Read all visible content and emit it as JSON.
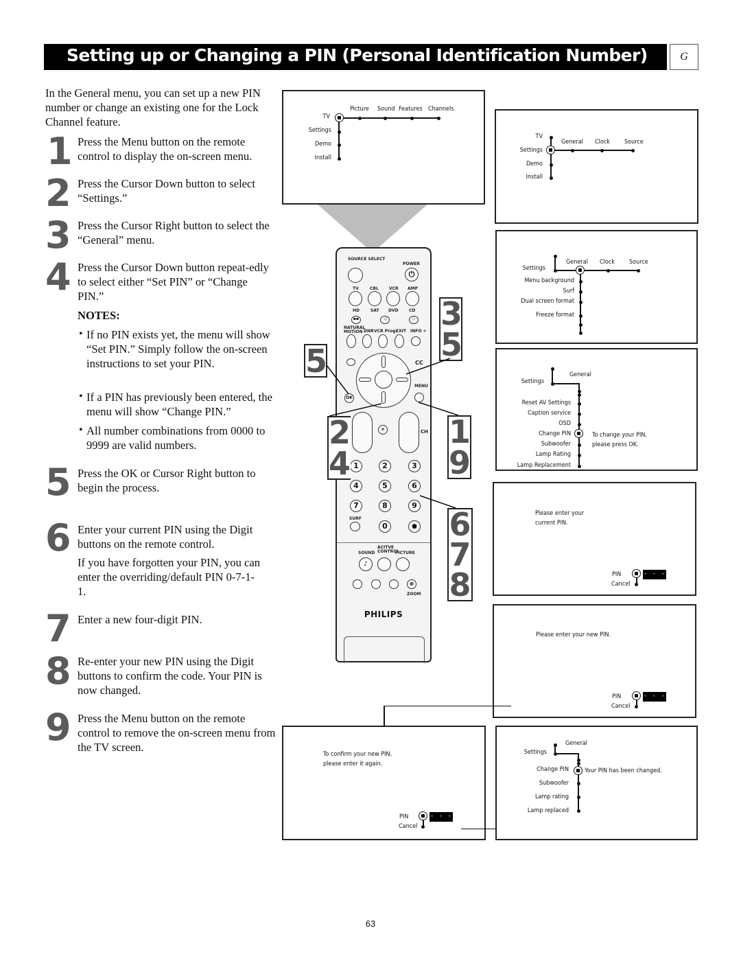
{
  "header": {
    "title": "Setting up or Changing a PIN (Personal Identification Number)",
    "section_letter": "G"
  },
  "intro": "In the General menu, you can set up a new PIN number or change an existing one for the Lock Channel feature.",
  "steps": [
    {
      "number": "1",
      "text": "Press the Menu button on the remote control to display the on-screen menu."
    },
    {
      "number": "2",
      "text": "Press the Cursor Down button to select “Settings.”"
    },
    {
      "number": "3",
      "text": "Press the Cursor Right button to select the “General” menu."
    },
    {
      "number": "4",
      "text": "Press the Cursor Down button repeat-edly to select either “Set PIN” or “Change PIN.”"
    },
    {
      "number": "5",
      "text": "Press the OK or Cursor Right button to begin the process."
    },
    {
      "number": "6",
      "text": "Enter your current PIN using the Digit buttons on the remote control.",
      "extra": "If you have forgotten your PIN, you can enter the overriding/default PIN 0-7-1-1."
    },
    {
      "number": "7",
      "text": "Enter a new four-digit PIN."
    },
    {
      "number": "8",
      "text": "Re-enter your new PIN using the Digit buttons to confirm the code. Your PIN is now changed."
    },
    {
      "number": "9",
      "text": "Press the Menu button on the remote control to remove the on-screen menu from the TV screen."
    }
  ],
  "notes": {
    "heading": "NOTES:",
    "items": [
      "If no PIN exists yet, the menu will show “Set PIN.” Simply follow the on-screen instructions to set your PIN.",
      "If a PIN has previously been entered, the menu will show “Change PIN.”",
      "All number combinations from 0000 to 9999 are valid numbers."
    ]
  },
  "screens": {
    "main_menu": {
      "root": "TV",
      "top_items": [
        "Picture",
        "Sound",
        "Features",
        "Channels"
      ],
      "side_items": [
        "Settings",
        "Demo",
        "Install"
      ]
    },
    "settings_menu": {
      "side_items": [
        "TV",
        "Settings",
        "Demo",
        "Install"
      ],
      "top_items": [
        "General",
        "Clock",
        "Source"
      ]
    },
    "general_menu": {
      "root": "Settings",
      "top_items": [
        "General",
        "Clock",
        "Source"
      ],
      "items": [
        "Menu background",
        "Surf",
        "Dual screen format",
        "Freeze format"
      ]
    },
    "change_pin_menu": {
      "root": "Settings",
      "header": "General",
      "items": [
        "Reset AV Settings",
        "Caption service",
        "OSD",
        "Change PIN",
        "Subwoofer",
        "Lamp Rating",
        "Lamp Replacement"
      ],
      "message": "To change your PIN, please press OK."
    },
    "enter_current": {
      "message": "Please enter your current PIN.",
      "pin_label": "PIN",
      "cancel_label": "Cancel",
      "pin_value": "- - - -"
    },
    "enter_new": {
      "message": "Please enter your new PIN.",
      "pin_label": "PIN",
      "cancel_label": "Cancel",
      "pin_value": "- - - -"
    },
    "confirm_new": {
      "message_line1": "To confirm your new PIN,",
      "message_line2": "please enter it again.",
      "pin_label": "PIN",
      "cancel_label": "Cancel",
      "pin_value": "- - - -"
    },
    "changed": {
      "root": "Settings",
      "header": "General",
      "items": [
        "Change PIN",
        "Subwoofer",
        "Lamp rating",
        "Lamp replaced"
      ],
      "message": "Your PIN has been changed."
    }
  },
  "remote": {
    "brand": "PHILIPS",
    "labels": {
      "source_select": "SOURCE SELECT",
      "power": "POWER",
      "tv": "TV",
      "cbl": "CBL",
      "vcr": "VCR",
      "amp": "AMP",
      "hd": "HD",
      "sat": "SAT",
      "dvd": "DVD",
      "cd": "CD",
      "natural_motion": "NATURAL MOTION",
      "dnr": "DNR",
      "vcr_prog": "VCR Prog.",
      "exit": "EXIT",
      "info": "INFO +",
      "cc": "CC",
      "ok": "OK",
      "menu": "MENU",
      "ch": "CH",
      "surf": "SURF",
      "active_control": "ACITVE CONTROL",
      "sound": "SOUND",
      "picture": "PICTURE",
      "zoom": "ZOOM"
    },
    "digits": [
      "1",
      "2",
      "3",
      "4",
      "5",
      "6",
      "7",
      "8",
      "9",
      "0"
    ],
    "callouts": {
      "right": "3 5",
      "ok": "5",
      "down": "2 4",
      "menu": "1 9",
      "digits": "6 7 8"
    }
  },
  "page_number": "63"
}
